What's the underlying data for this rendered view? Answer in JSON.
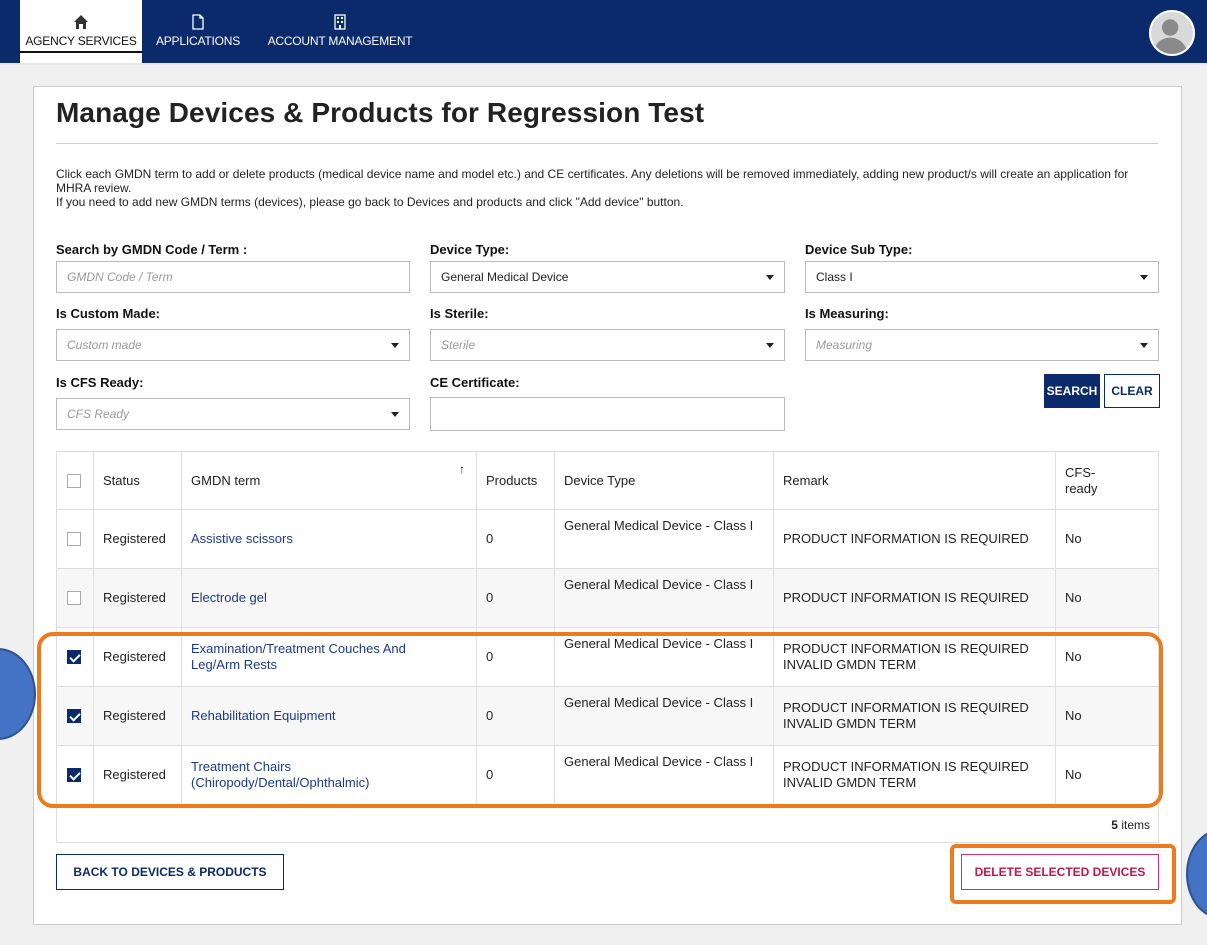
{
  "nav": {
    "items": [
      {
        "label": "AGENCY SERVICES",
        "icon": "home-icon",
        "active": true
      },
      {
        "label": "APPLICATIONS",
        "icon": "document-icon",
        "active": false
      },
      {
        "label": "ACCOUNT MANAGEMENT",
        "icon": "building-icon",
        "active": false
      }
    ]
  },
  "page": {
    "title": "Manage Devices & Products for Regression Test",
    "intro_line1": "Click each GMDN term to add or delete products (medical device name and model etc.) and CE certificates. Any deletions will be removed immediately, adding new product/s will create an application for MHRA review.",
    "intro_line2": "If you need to add new GMDN terms (devices), please go back to Devices and products and click \"Add device\" button."
  },
  "filters": {
    "gmdn": {
      "label": "Search by GMDN Code / Term :",
      "placeholder": "GMDN Code / Term"
    },
    "device_type": {
      "label": "Device Type:",
      "value": "General Medical Device"
    },
    "device_sub_type": {
      "label": "Device Sub Type:",
      "value": "Class I"
    },
    "custom_made": {
      "label": "Is Custom Made:",
      "placeholder": "Custom made"
    },
    "sterile": {
      "label": "Is Sterile:",
      "placeholder": "Sterile"
    },
    "measuring": {
      "label": "Is Measuring:",
      "placeholder": "Measuring"
    },
    "cfs_ready": {
      "label": "Is CFS Ready:",
      "placeholder": "CFS Ready"
    },
    "ce_certificate": {
      "label": "CE Certificate:",
      "value": ""
    },
    "search_label": "SEARCH",
    "clear_label": "CLEAR"
  },
  "table": {
    "headers": {
      "status": "Status",
      "gmdn": "GMDN term",
      "sort_icon": "↑",
      "products": "Products",
      "device_type": "Device Type",
      "remark": "Remark",
      "cfs_line1": "CFS-",
      "cfs_line2": "ready"
    },
    "rows": [
      {
        "checked": false,
        "status": "Registered",
        "gmdn": "Assistive scissors",
        "products": "0",
        "device_type": "General Medical Device - Class I",
        "remark1": "PRODUCT INFORMATION IS REQUIRED",
        "remark2": "",
        "cfs": "No"
      },
      {
        "checked": false,
        "status": "Registered",
        "gmdn": "Electrode gel",
        "products": "0",
        "device_type": "General Medical Device - Class I",
        "remark1": "PRODUCT INFORMATION IS REQUIRED",
        "remark2": "",
        "cfs": "No"
      },
      {
        "checked": true,
        "status": "Registered",
        "gmdn": "Examination/Treatment Couches And Leg/Arm Rests",
        "products": "0",
        "device_type": "General Medical Device - Class I",
        "remark1": "PRODUCT INFORMATION IS REQUIRED",
        "remark2": "INVALID GMDN TERM",
        "cfs": "No"
      },
      {
        "checked": true,
        "status": "Registered",
        "gmdn": "Rehabilitation Equipment",
        "products": "0",
        "device_type": "General Medical Device - Class I",
        "remark1": "PRODUCT INFORMATION IS REQUIRED",
        "remark2": "INVALID GMDN TERM",
        "cfs": "No"
      },
      {
        "checked": true,
        "status": "Registered",
        "gmdn": "Treatment Chairs (Chiropody/Dental/Ophthalmic)",
        "products": "0",
        "device_type": "General Medical Device - Class I",
        "remark1": "PRODUCT INFORMATION IS REQUIRED",
        "remark2": "INVALID GMDN TERM",
        "cfs": "No"
      }
    ],
    "items_count": "5",
    "items_suffix": " items"
  },
  "actions": {
    "back_label": "BACK TO DEVICES & PRODUCTS",
    "delete_label": "DELETE SELECTED DEVICES"
  },
  "colors": {
    "nav_bg": "#0a2a6b",
    "link": "#1a3a8a",
    "delete": "#c4164a",
    "annotation": "#ee7a1e",
    "marker": "#4472c4"
  }
}
